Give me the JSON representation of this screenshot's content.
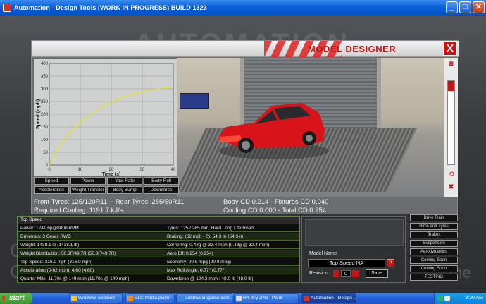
{
  "window": {
    "title": "Automation - Design Tools   (WORK IN PROGRESS)   BUILD 1323",
    "minimize": "_",
    "maximize": "□",
    "close": "✕"
  },
  "background": {
    "logo": "AUTOMATION",
    "text_left_1": "C",
    "text_left_2": "O",
    "text_right": "me"
  },
  "panel": {
    "title": "MODEL DESIGNER",
    "close_label": "X"
  },
  "chart_data": {
    "type": "line",
    "title": "",
    "xlabel": "Time (s)",
    "ylabel": "Speed (mph)",
    "xlim": [
      0,
      40
    ],
    "ylim": [
      0,
      400
    ],
    "xticks": [
      "0",
      "10",
      "20",
      "30",
      "40"
    ],
    "yticks": [
      "0",
      "50",
      "100",
      "150",
      "200",
      "250",
      "300",
      "350",
      "400"
    ],
    "grid": true,
    "series": [
      {
        "color": "#e8e020",
        "x": [
          0,
          1,
          2,
          4,
          6,
          8,
          10,
          12,
          14,
          16,
          18,
          20,
          22,
          24,
          26,
          28,
          30,
          32,
          34,
          36,
          38,
          40
        ],
        "y": [
          0,
          25,
          50,
          88,
          118,
          145,
          168,
          188,
          206,
          222,
          236,
          248,
          259,
          268,
          276,
          283,
          289,
          294,
          298,
          302,
          305,
          308
        ]
      }
    ]
  },
  "chart_buttons": [
    {
      "label": "Speed"
    },
    {
      "label": "Power"
    },
    {
      "label": "Yaw Rate"
    },
    {
      "label": "Body Roll"
    },
    {
      "label": "Acceleration"
    },
    {
      "label": "Weight Transfer"
    },
    {
      "label": "Body Bump"
    },
    {
      "label": "Downforce"
    }
  ],
  "stats": {
    "tyres": "Front Tyres: 125/120R11 -- Rear Tyres: 285/50R11",
    "cooling_required": "Required Cooling: 1191.7 kJ/s",
    "body_cd": "Body CD 0.214 - Fixtures CD 0.040",
    "cooling_cd": "Cooling CD 0.000 - Total CD 0.254"
  },
  "info": {
    "header": "Top Speed",
    "left": [
      "Power: 1241 hp@8800 RPM",
      "Drivetrain: 3 Gears RWD",
      "Weight: 1438.1 lb (1438.1 lb)",
      "Weight Distribution: 50.3F/49.7R (50.3F/49.7R)",
      "Top Speed: 316.0 mph (316.0 mph)",
      "Acceleration (0-62 mph): 4.60 (4.60)",
      "Quarter Mile: 11.70s @ 149 mph (11.70s @ 149 mph)"
    ],
    "right": [
      "Tyres: 125 / 285 mm, Hard Long Life Road",
      "Braking: (62 mph - 0): 54.3 m (54.3 m)",
      "Cornering: 0.43g @ 32.4 mph (0.43g @ 32.4 mph)",
      "Aero Eff: 0.254 (0.254)",
      "Economy: 20.8 mpg (20.8 mpg)",
      "Max Roll Angle: 0.77° (0.77°)",
      "Downforce @ 124.3 mph : 48.0 lb (48.0 lb)"
    ]
  },
  "model": {
    "name_label": "Model Name",
    "name_value": "Top Speed NA",
    "clear_label": "✕",
    "revision_label": "Revision",
    "revision_value": "0",
    "save_label": "Save"
  },
  "nav_buttons": [
    {
      "label": "Drive Train"
    },
    {
      "label": "Rims and Tyres"
    },
    {
      "label": "Brakes"
    },
    {
      "label": "Suspension"
    },
    {
      "label": "Aerodynamics"
    },
    {
      "label": "Coming Soon"
    },
    {
      "label": "Coming Soon"
    },
    {
      "label": "TESTING"
    }
  ],
  "taskbar": {
    "start": "start",
    "tasks": [
      {
        "label": "Windows Explorer"
      },
      {
        "label": "VLC media player"
      },
      {
        "label": "automationgame.com..."
      },
      {
        "label": "H4-2Fy.JPG - Paint"
      },
      {
        "label": "Automation - Design ..."
      }
    ],
    "clock": "9:30 AM"
  },
  "colors": {
    "accent_red": "#c41414",
    "chart_line": "#e8e020",
    "info_border": "#5a8a3a"
  }
}
